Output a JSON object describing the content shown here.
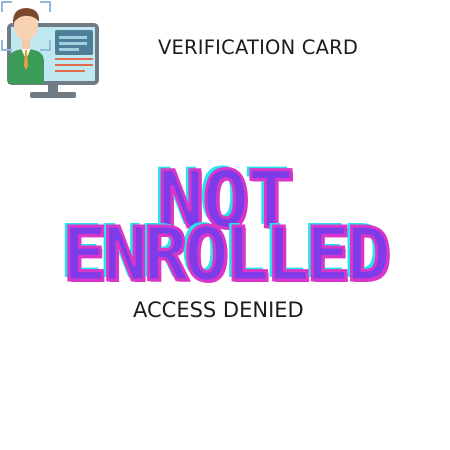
{
  "card": {
    "title": "VERIFICATION CARD",
    "status_line_1": "NOT",
    "status_line_2": "ENROLLED",
    "subtitle": "ACCESS DENIED"
  },
  "colors": {
    "status_fill": "#7e3ce8",
    "status_outline": "#d936c9",
    "status_glow": "#27e3f0",
    "text": "#1c1c1c",
    "monitor": "#6f7c86",
    "monitor_screen": "#bfe8f0",
    "id_card": "#4f7f98"
  },
  "icons": {
    "illustration": "verification-monitor-person-icon"
  }
}
